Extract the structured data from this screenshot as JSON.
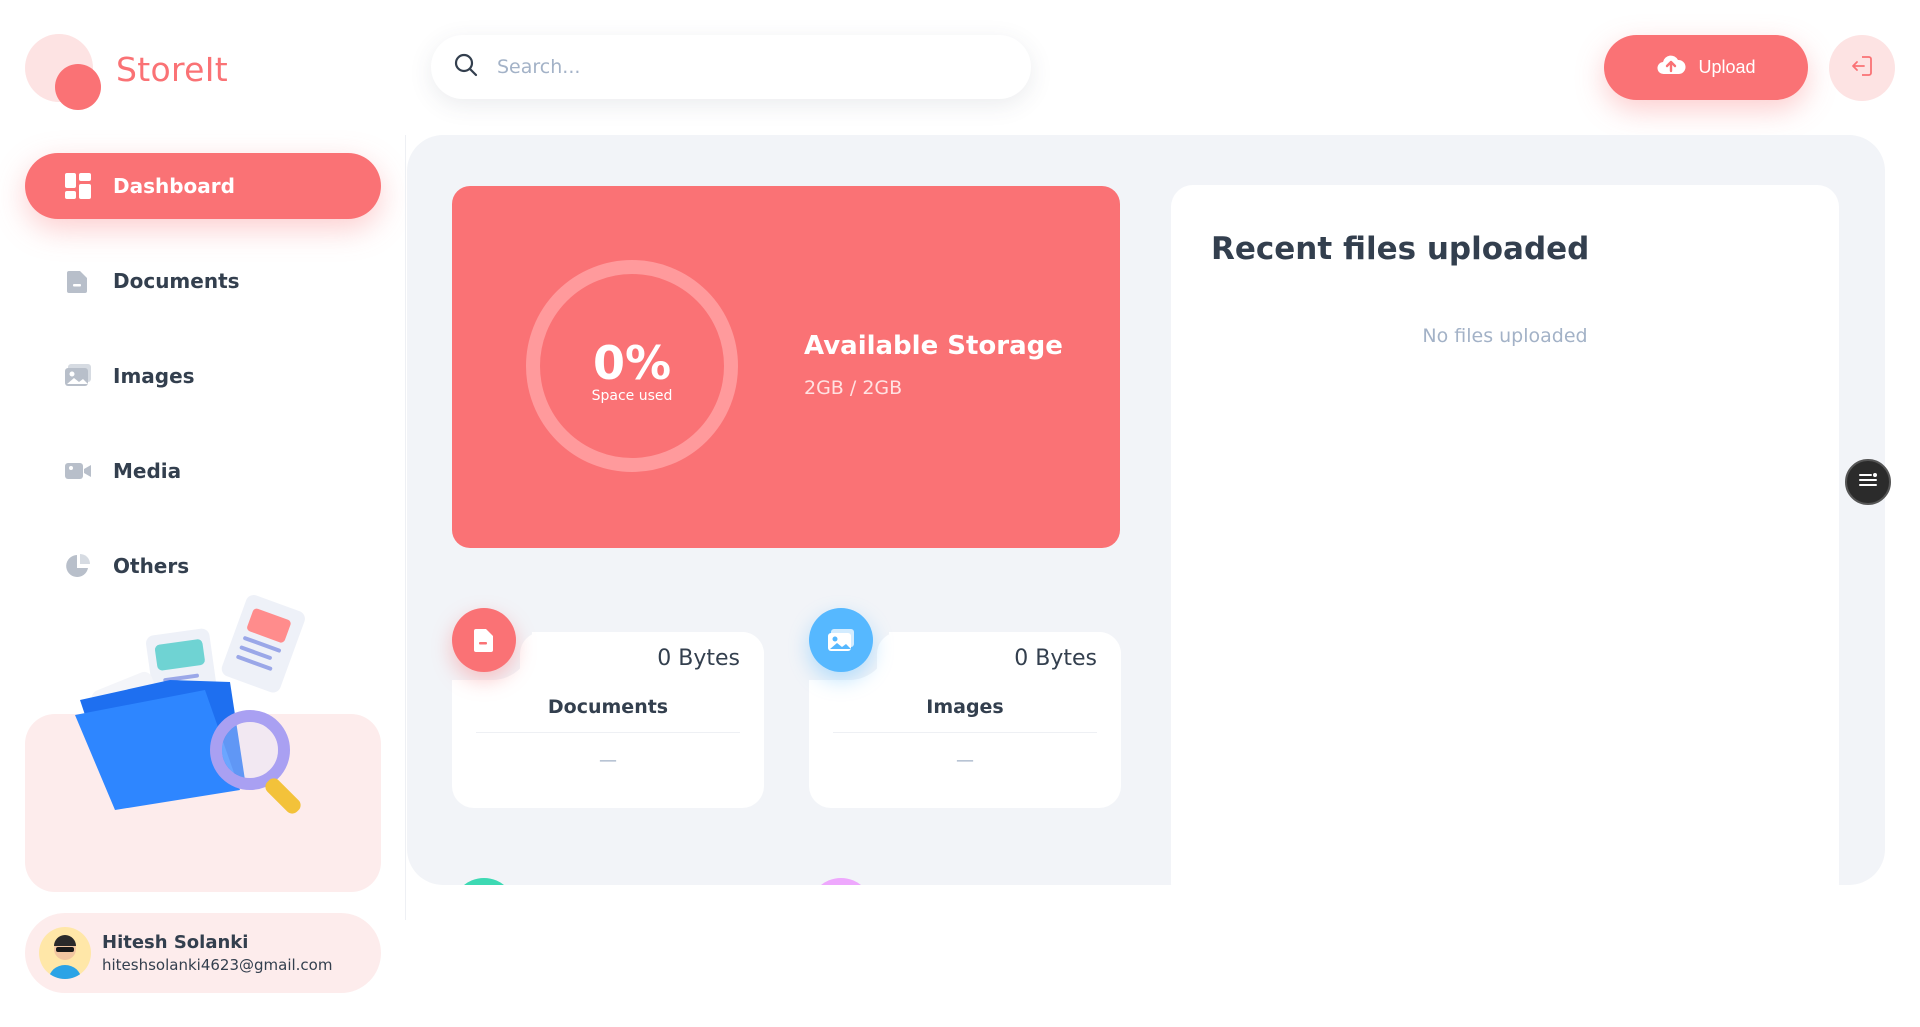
{
  "brand": {
    "name": "StoreIt",
    "color": "#FA7275"
  },
  "search": {
    "placeholder": "Search..."
  },
  "header": {
    "upload_label": "Upload",
    "upload_icon": "cloud-upload-icon",
    "logout_icon": "logout-icon"
  },
  "sidebar": {
    "items": [
      {
        "label": "Dashboard",
        "icon": "dashboard-icon",
        "active": true
      },
      {
        "label": "Documents",
        "icon": "document-icon"
      },
      {
        "label": "Images",
        "icon": "image-icon"
      },
      {
        "label": "Media",
        "icon": "video-icon"
      },
      {
        "label": "Others",
        "icon": "pie-chart-icon"
      }
    ]
  },
  "user": {
    "name": "Hitesh Solanki",
    "email": "hiteshsolanki4623@gmail.com"
  },
  "storage": {
    "percent_label": "0%",
    "percent_value": 0,
    "caption": "Space used",
    "title": "Available Storage",
    "amount": "2GB / 2GB"
  },
  "summary": [
    {
      "size": "0 Bytes",
      "label": "Documents",
      "date": "—",
      "color": "#FA7275",
      "icon": "document-icon"
    },
    {
      "size": "0 Bytes",
      "label": "Images",
      "date": "—",
      "color": "#56B8FF",
      "icon": "image-icon"
    }
  ],
  "recent": {
    "title": "Recent files uploaded",
    "empty": "No files uploaded"
  }
}
